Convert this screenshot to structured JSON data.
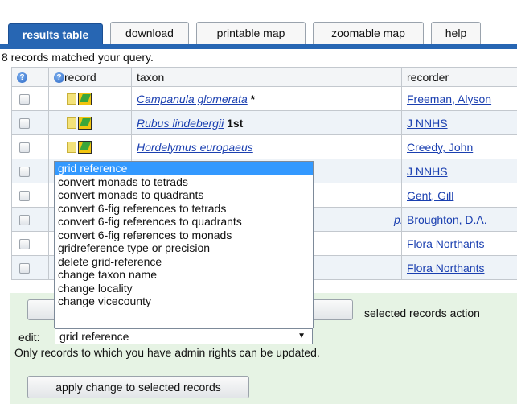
{
  "tabs": [
    {
      "label": "results table",
      "active": true
    },
    {
      "label": "download",
      "active": false
    },
    {
      "label": "printable map",
      "active": false
    },
    {
      "label": "zoomable map",
      "active": false
    },
    {
      "label": "help",
      "active": false
    }
  ],
  "status": "8 records matched your query.",
  "table": {
    "headers": [
      "",
      "record",
      "taxon",
      "recorder"
    ],
    "rows": [
      {
        "taxon": "Campanula glomerata",
        "suffix": " *",
        "recorder": "Freeman, Alyson"
      },
      {
        "taxon": "Rubus lindebergii",
        "suffix": " 1st",
        "recorder": "J NNHS"
      },
      {
        "taxon": "Hordelymus europaeus",
        "suffix": "",
        "recorder": "Creedy, John"
      },
      {
        "taxon": "",
        "suffix": "",
        "recorder": "J NNHS"
      },
      {
        "taxon": "",
        "suffix": "",
        "recorder": "Gent, Gill"
      },
      {
        "taxon": "p. japonica",
        "suffix": "",
        "recorder": "Broughton, D.A."
      },
      {
        "taxon": "",
        "suffix": "",
        "recorder": "Flora Northants"
      },
      {
        "taxon": "",
        "suffix": "",
        "recorder": "Flora Northants"
      }
    ]
  },
  "dropdown": {
    "options": [
      "grid reference",
      "convert monads to tetrads",
      "convert monads to quadrants",
      "convert 6-fig references to tetrads",
      "convert 6-fig references to quadrants",
      "convert 6-fig references to monads",
      "gridreference type or precision",
      "delete grid-reference",
      "change taxon name",
      "change locality",
      "change vicecounty"
    ],
    "selected": "grid reference"
  },
  "actions": {
    "selected_records_action": "selected records action",
    "edit_label": "edit:",
    "edit_value": "grid reference",
    "admin_note": "Only records to which you have admin rights can be updated.",
    "apply_button": "apply change to selected records"
  },
  "colors": {
    "tab_active": "#2766b3",
    "link": "#1a3fb0",
    "panel": "#e6f3e4",
    "highlight": "#3399ff"
  }
}
